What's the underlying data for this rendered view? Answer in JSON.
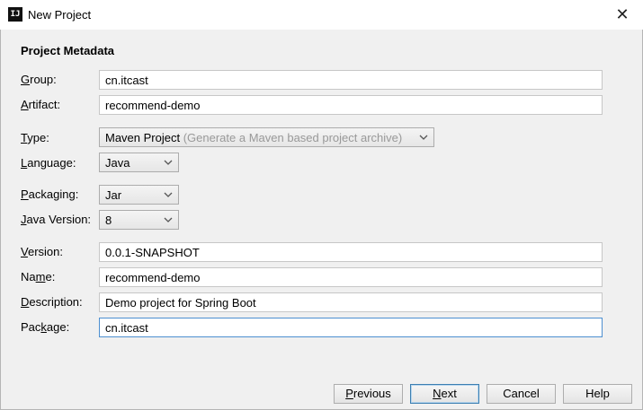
{
  "window": {
    "title": "New Project",
    "app_icon_text": "IJ",
    "close_glyph": "✕"
  },
  "section_title": "Project Metadata",
  "fields": {
    "group": {
      "label_key": "G",
      "label_rest": "roup:",
      "value": "cn.itcast"
    },
    "artifact": {
      "label_key": "A",
      "label_rest": "rtifact:",
      "value": "recommend-demo"
    },
    "type": {
      "label_key": "T",
      "label_rest": "ype:",
      "value": "Maven Project",
      "hint": "(Generate a Maven based project archive)"
    },
    "language": {
      "label_key": "L",
      "label_rest": "anguage:",
      "value": "Java"
    },
    "packaging": {
      "label_key": "P",
      "label_rest": "ackaging:",
      "value": "Jar"
    },
    "java_version": {
      "label_key": "J",
      "label_rest": "ava Version:",
      "value": "8"
    },
    "version": {
      "label_key": "V",
      "label_rest": "ersion:",
      "value": "0.0.1-SNAPSHOT"
    },
    "name": {
      "label_pre": "Na",
      "label_key": "m",
      "label_rest": "e:",
      "value": "recommend-demo"
    },
    "description": {
      "label_key": "D",
      "label_rest": "escription:",
      "value": "Demo project for Spring Boot"
    },
    "package": {
      "label_pre": "Pac",
      "label_key": "k",
      "label_rest": "age:",
      "value": "cn.itcast"
    }
  },
  "buttons": {
    "previous": {
      "key": "P",
      "rest": "revious"
    },
    "next": {
      "key": "N",
      "rest": "ext"
    },
    "cancel": "Cancel",
    "help": "Help"
  }
}
